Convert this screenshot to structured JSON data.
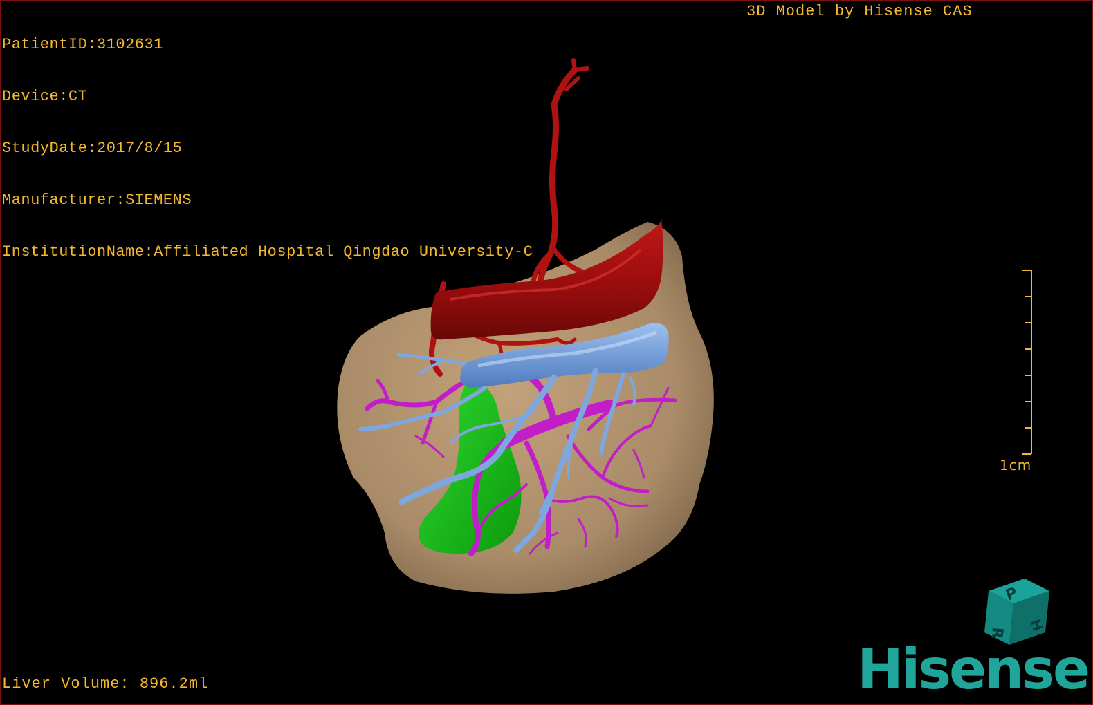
{
  "patient_info": {
    "patient_id": "PatientID:3102631",
    "device": "Device:CT",
    "study_date": "StudyDate:2017/8/15",
    "manufacturer": "Manufacturer:SIEMENS",
    "institution": "InstitutionName:Affiliated Hospital Qingdao University-C"
  },
  "credit": "3D Model by Hisense CAS",
  "liver_volume": "Liver Volume: 896.2ml",
  "scale": {
    "label": "1cm"
  },
  "orientation_cube": {
    "faces": {
      "front": "P",
      "side": "H",
      "bottom": "R"
    }
  },
  "logo": {
    "text": "Hisense"
  },
  "colors": {
    "overlay_text": "#f4b82e",
    "liver": "#a98b68",
    "artery": "#a01010",
    "vein": "#6f9ad6",
    "portal_vein": "#c020c8",
    "gallbladder": "#1fbf1f",
    "logo": "#1fa59a"
  }
}
